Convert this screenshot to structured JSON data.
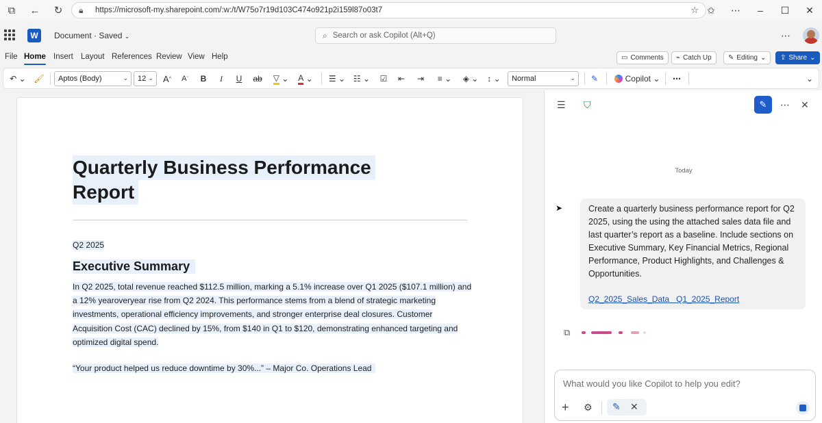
{
  "browser": {
    "url": "https://microsoft-my.sharepoint.com/:w:/t/W75o7r19d103C474o921p2i159l87o03t7",
    "back_icon": "back-arrow-icon",
    "refresh_icon": "refresh-icon"
  },
  "app": {
    "doc_title": "Document · Saved",
    "search_placeholder": "Search or ask Copilot (Alt+Q)"
  },
  "menu": {
    "tabs": [
      "File",
      "Home",
      "Insert",
      "Layout",
      "References",
      "Review",
      "View",
      "Help"
    ],
    "active_tab": "Home",
    "comments": "Comments",
    "catch_up": "Catch Up",
    "editing": "Editing",
    "share": "Share"
  },
  "toolbar": {
    "font": "Aptos (Body)",
    "size": "12",
    "style": "Normal",
    "copilot": "Copilot",
    "font_color": "#d13438",
    "highlight_color": "#f2c811"
  },
  "document": {
    "title_line1": "Quarterly Business Performance",
    "title_line2": "Report",
    "date": "Q2 2025",
    "section_heading": "Executive Summary",
    "para_lines": [
      "In Q2 2025, total revenue reached $112.5 million, marking a 5.1% increase over Q1 2025 ($107.1 million) and",
      "a 12% yearoveryear rise from Q2 2024. This performance stems from a blend of strategic marketing",
      "investments, operational efficiency improvements, and stronger enterprise deal closures. Customer",
      "Acquisition Cost (CAC) declined by 15%, from $140 in Q1 to $120, demonstrating enhanced targeting and",
      "optimized digital spend."
    ],
    "quote": "“Your product helped us reduce downtime by 30%...” – Major Co. Operations Lead"
  },
  "copilot": {
    "today": "Today",
    "prompt": "Create a quarterly business performance report for Q2 2025, using the using the attached sales data file and last quarter’s report as a baseline. Include sections on Executive Summary, Key Financial Metrics, Regional Performance, Product Highlights, and Challenges & Opportunities.",
    "attachment1": "Q2_2025_Sales_Data",
    "attachment2": "Q1_2025_Report",
    "input_placeholder": "What would you like Copilot to help you edit?",
    "accent": "#1f5dcc"
  }
}
